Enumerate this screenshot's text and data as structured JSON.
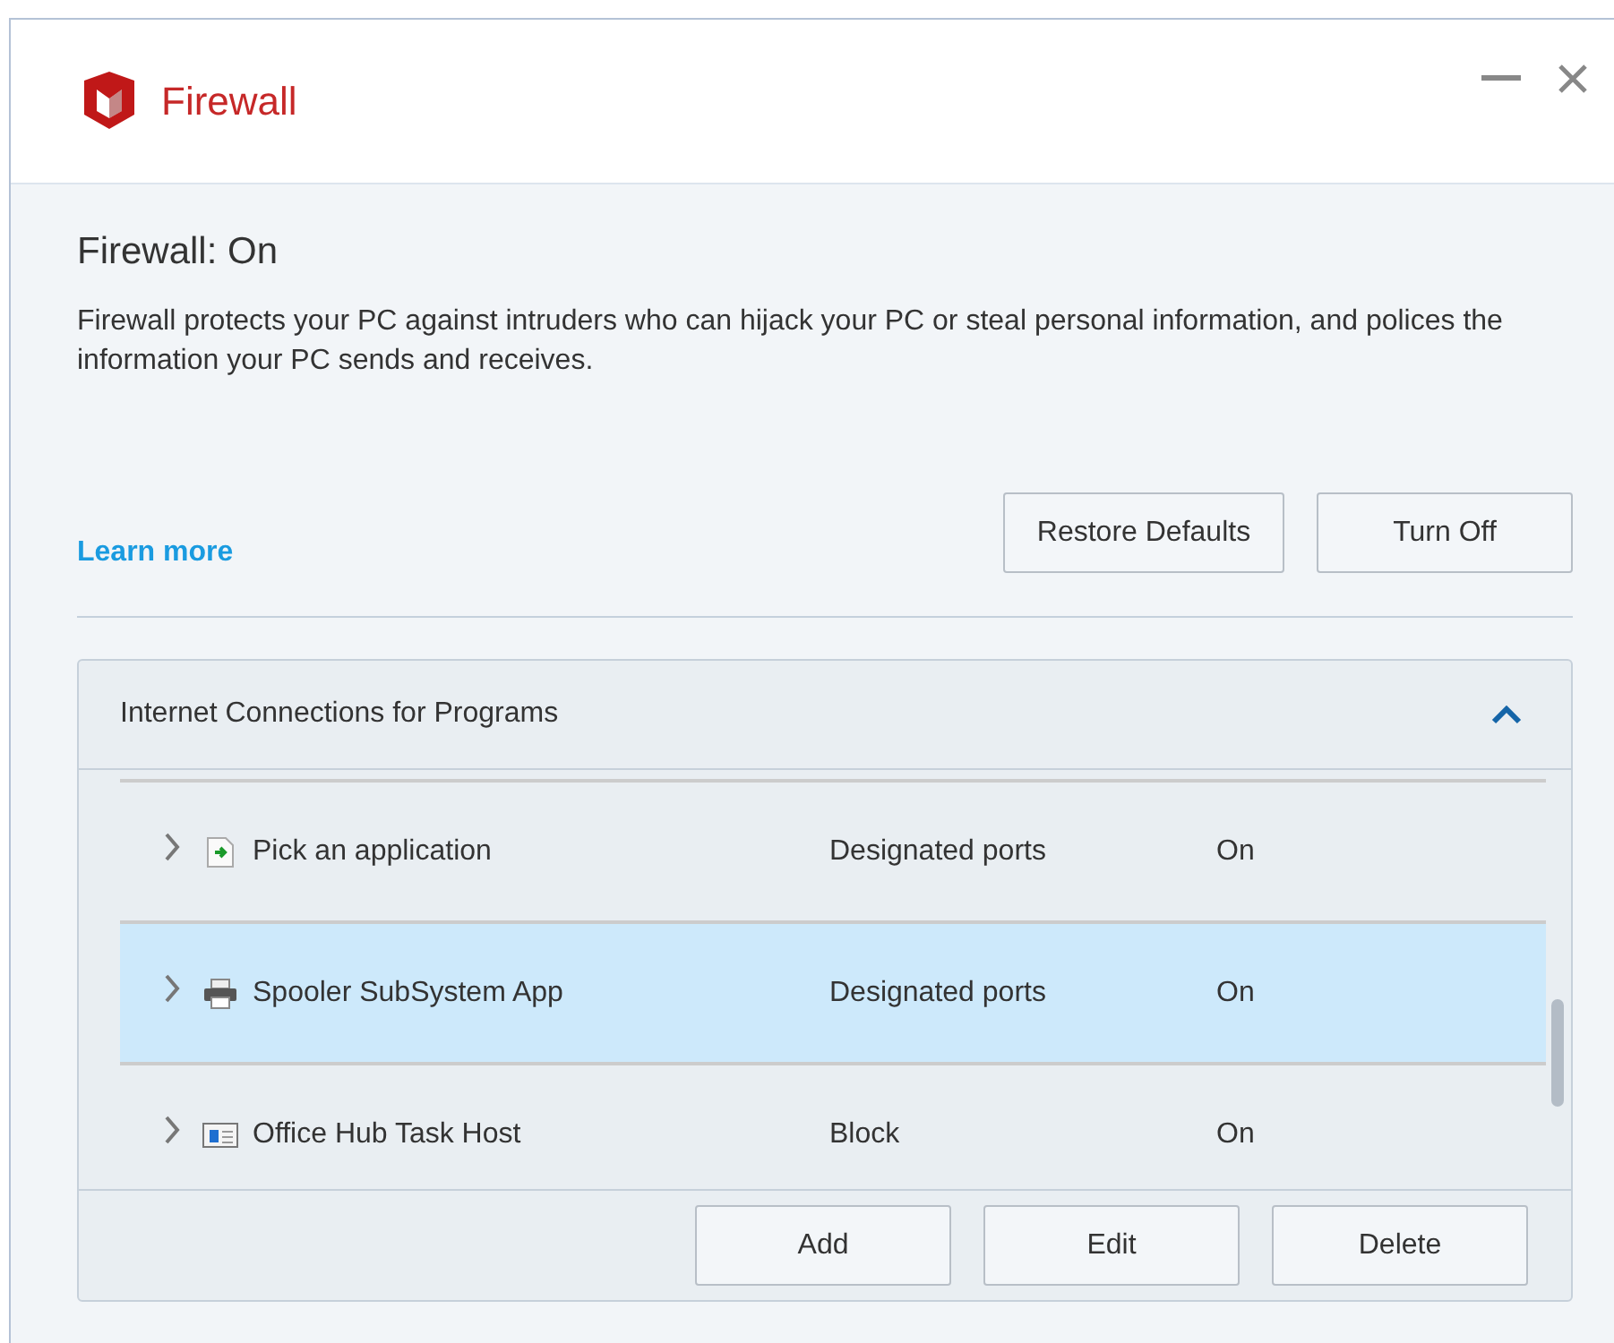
{
  "window": {
    "title": "Firewall"
  },
  "status": {
    "heading": "Firewall: On",
    "description": "Firewall protects your PC against intruders who can hijack your PC or steal personal information, and polices the information your PC sends and receives."
  },
  "learn_more": "Learn more",
  "actions": [
    "Restore Defaults",
    "Turn Off"
  ],
  "panel": {
    "title": "Internet Connections for Programs",
    "expanded": true,
    "rows": [
      {
        "kind": "document",
        "name": "Pick an application",
        "access": "Designated ports",
        "state": "On",
        "selected": false
      },
      {
        "kind": "printer",
        "name": "Spooler SubSystem App",
        "access": "Designated ports",
        "state": "On",
        "selected": true
      },
      {
        "kind": "window",
        "name": "Office Hub Task Host",
        "access": "Block",
        "state": "On",
        "selected": false
      }
    ],
    "buttons": [
      "Add",
      "Edit",
      "Delete"
    ]
  }
}
